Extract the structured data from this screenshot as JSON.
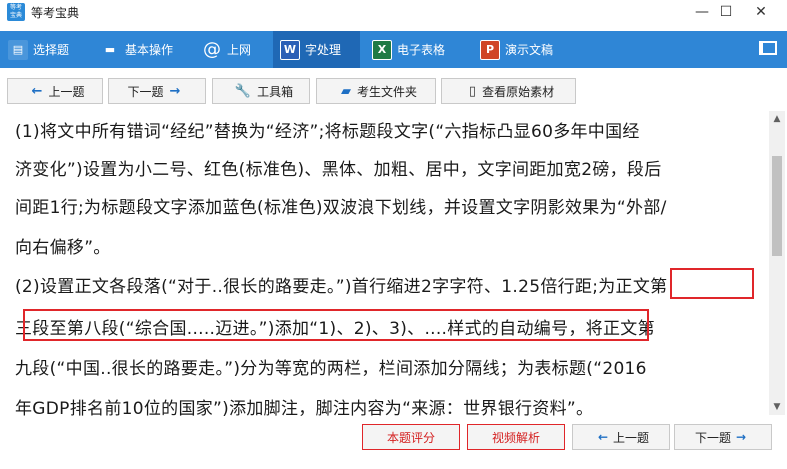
{
  "window": {
    "title": "等考宝典",
    "icon_text": "等考 宝典",
    "minimize": "—",
    "maximize": "☐",
    "close": "✕"
  },
  "menu": {
    "items": [
      {
        "label": "选择题",
        "icon": "clipboard-icon",
        "glyph": "▤"
      },
      {
        "label": "基本操作",
        "icon": "monitor-icon",
        "glyph": "▬"
      },
      {
        "label": "上网",
        "icon": "at-icon",
        "glyph": "@"
      },
      {
        "label": "字处理",
        "icon": "word-icon",
        "glyph": "W"
      },
      {
        "label": "电子表格",
        "icon": "excel-icon",
        "glyph": "X"
      },
      {
        "label": "演示文稿",
        "icon": "powerpoint-icon",
        "glyph": "P"
      }
    ],
    "active_index": 3,
    "colors": {
      "bar": "#2f86d6",
      "active": "#1f68b5",
      "word": "#2b5fb6",
      "excel": "#1f7a45",
      "ppt": "#d04526"
    }
  },
  "toolbar": {
    "prev_label": "上一题",
    "next_label": "下一题",
    "tools_label": "工具箱",
    "folder_label": "考生文件夹",
    "material_label": "查看原始素材"
  },
  "content": {
    "lines": [
      "(1)将文中所有错词“经纪”替换为“经济”;将标题段文字(“六指标凸显60多年中国经",
      "济变化”)设置为小二号、红色(标准色)、黑体、加粗、居中，文字间距加宽2磅，段后",
      "间距1行;为标题段文字添加蓝色(标准色)双波浪下划线，并设置文字阴影效果为“外部/",
      "向右偏移”。",
      "(2)设置正文各段落(“对于..很长的路要走。”)首行缩进2字字符、1.25倍行距;为正文第",
      "三段至第八段(“综合国.....迈进。”)添加“1)、2)、3)、....样式的自动编号，将正文第",
      "九段(“中国..很长的路要走。”)分为等宽的两栏，栏间添加分隔线；为表标题(“2016",
      "年GDP排名前10位的国家”)添加脚注，脚注内容为“来源：世界银行资料”。"
    ],
    "highlight_color": "#e0262a"
  },
  "bottom": {
    "score_label": "本题评分",
    "video_label": "视频解析",
    "prev_label": "上一题",
    "next_label": "下一题"
  }
}
